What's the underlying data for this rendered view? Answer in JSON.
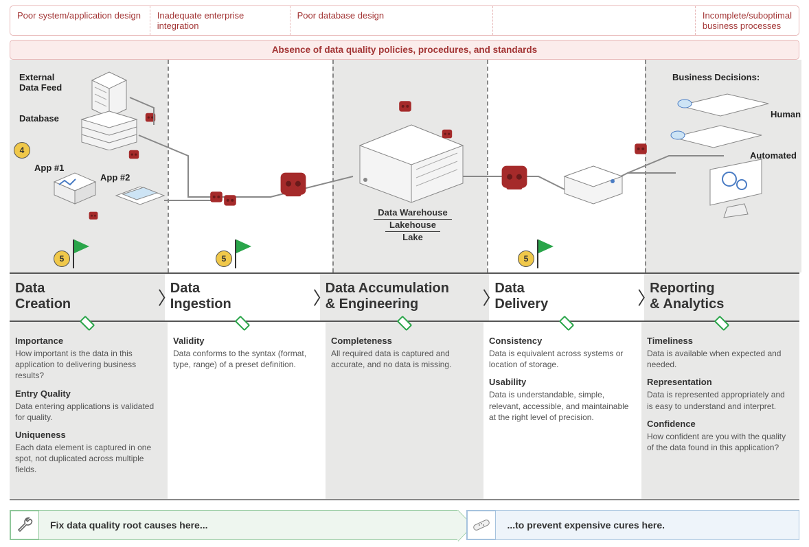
{
  "topcats": [
    "Poor system/application design",
    "Inadequate enterprise integration",
    "Poor database design",
    "",
    "Incomplete/suboptimal business processes"
  ],
  "absence": "Absence of data quality policies, procedures, and standards",
  "diagram": {
    "externalFeed": "External\nData Feed",
    "database": "Database",
    "app1": "App #1",
    "app2": "App #2",
    "warehouse1": "Data Warehouse",
    "warehouse2": "Lakehouse",
    "warehouse3": "Lake",
    "bizDecisions": "Business Decisions:",
    "human": "Human",
    "automated": "Automated",
    "badge4": "4",
    "flag5": "5"
  },
  "stages": [
    {
      "title": "Data\nCreation"
    },
    {
      "title": "Data\nIngestion"
    },
    {
      "title": "Data Accumulation\n& Engineering"
    },
    {
      "title": "Data\nDelivery"
    },
    {
      "title": "Reporting\n& Analytics"
    }
  ],
  "descs": [
    [
      {
        "h": "Importance",
        "p": "How important is the data in this application to delivering business results?"
      },
      {
        "h": "Entry Quality",
        "p": "Data entering applications is validated for quality."
      },
      {
        "h": "Uniqueness",
        "p": "Each data element is captured in one spot, not duplicated across multiple fields."
      }
    ],
    [
      {
        "h": "Validity",
        "p": "Data conforms to the syntax (format, type, range) of a preset definition."
      }
    ],
    [
      {
        "h": "Completeness",
        "p": "All required data is captured and accurate, and no data is missing."
      }
    ],
    [
      {
        "h": "Consistency",
        "p": "Data is equivalent across systems or location of storage."
      },
      {
        "h": "Usability",
        "p": "Data is understandable, simple, relevant, accessible, and maintainable at the right level of precision."
      }
    ],
    [
      {
        "h": "Timeliness",
        "p": "Data is available when expected and needed."
      },
      {
        "h": "Representation",
        "p": "Data is represented appropriately and is easy to understand and interpret."
      },
      {
        "h": "Confidence",
        "p": "How confident are you with the quality of the data found in this application?"
      }
    ]
  ],
  "footer": {
    "fix": "Fix data quality root causes here...",
    "cure": "...to prevent expensive cures here."
  }
}
